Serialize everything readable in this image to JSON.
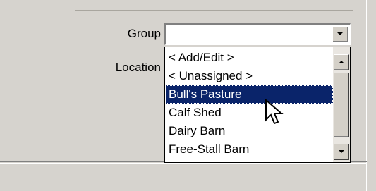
{
  "form": {
    "group": {
      "label": "Group",
      "value": ""
    },
    "location": {
      "label": "Location",
      "options": [
        "< Add/Edit >",
        "< Unassigned >",
        "Bull's Pasture",
        "Calf Shed",
        "Dairy Barn",
        "Free-Stall Barn"
      ],
      "highlighted": "Bull's Pasture"
    }
  },
  "icons": {
    "combo_button": "chevron-down-icon",
    "scroll_up": "arrow-up-icon",
    "scroll_down": "arrow-down-icon",
    "cursor": "mouse-pointer-icon"
  },
  "colors": {
    "panel_background": "#d6d3ce",
    "selection_background": "#0a246a",
    "selection_text": "#ffffff"
  }
}
